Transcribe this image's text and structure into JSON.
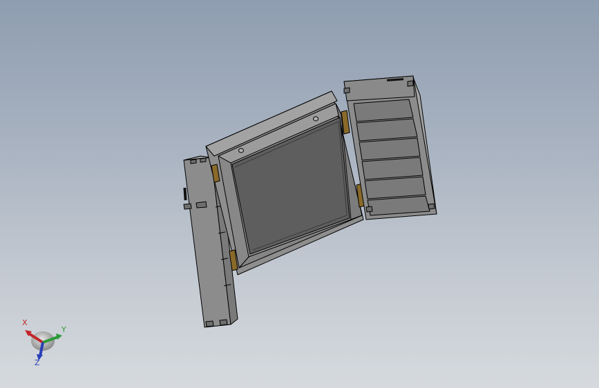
{
  "viewport": {
    "background_top": "#8e9db0",
    "background_bottom": "#d6dade"
  },
  "model": {
    "body_color": "#8a8a8a",
    "face_dark": "#5c5c5c",
    "edge_color": "#000000",
    "hinge_color": "#8a6a2a"
  },
  "triad": {
    "x_label": "X",
    "y_label": "Y",
    "z_label": "Z",
    "x_color": "#c0262a",
    "y_color": "#2e9a3a",
    "z_color": "#2a3fb8"
  }
}
